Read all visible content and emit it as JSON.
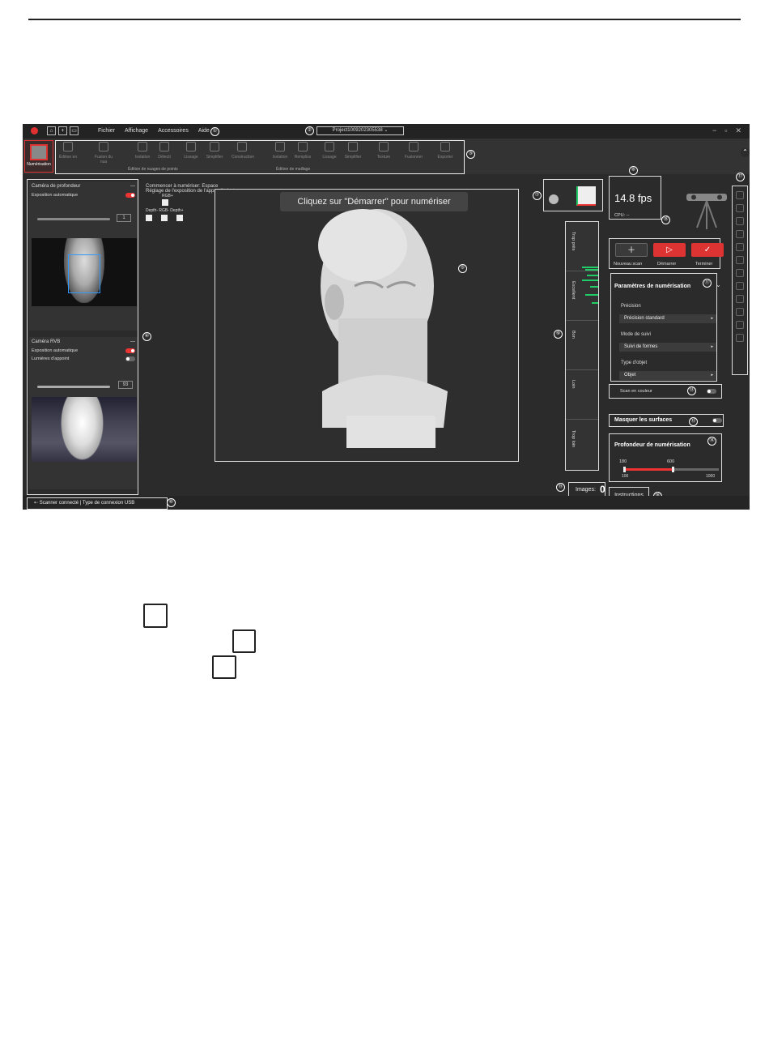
{
  "app": {
    "menu": [
      "Fichier",
      "Affichage",
      "Accessoires",
      "Aide"
    ],
    "project": "Project1009202305538 ⌄",
    "window_controls": [
      "−",
      "▫",
      "✕"
    ],
    "annotations": {
      "a1": "①",
      "a2": "②",
      "a3": "③",
      "a4": "④",
      "a5": "⑤",
      "a6": "⑥",
      "a7": "⑦",
      "a8": "⑧",
      "a9": "⑨",
      "a10": "⑩",
      "a11": "⑪",
      "a12": "⑫",
      "a13": "⑬",
      "a14": "⑭",
      "a15": "⑮",
      "a16": "⑯",
      "a17": "⑰",
      "a18": "⑱"
    },
    "toolbar": {
      "scan_label": "Numérisation",
      "tools": [
        "Édition en",
        "Fusion du nua",
        "Isolation",
        "Détecti",
        "Lissage",
        "Simplifier",
        "Construction",
        "Isolation",
        "Rempliss",
        "Lissage",
        "Simplifier",
        "Texture",
        "Fusionner",
        "Exporter"
      ],
      "group1": "Édition de nuages de points",
      "group2": "Édition de maillage"
    },
    "depth_camera": {
      "title": "Caméra de profondeur",
      "auto_exposure": "Exposition automatique",
      "value": "1"
    },
    "rgb_camera": {
      "title": "Caméra RVB",
      "auto_exposure": "Exposition automatique",
      "fill_light": "Lumières d'appoint",
      "value": "93"
    },
    "start": {
      "line1": "Commencer à numériser: Espace",
      "line2": "Réglage de l'exposition de l'appareil photo:",
      "rgb_plus": "RGB+",
      "labels": "Depth-  RGB-  Depth+"
    },
    "viewport_message": "Cliquez sur \"Démarrer\" pour numériser",
    "quality_levels": [
      "Trop près",
      "Excellent",
      "Bon",
      "Loin",
      "Trop loin"
    ],
    "images_label": "Images:",
    "images_count": "0",
    "fps": "14.8 fps",
    "cpu": "CPU: --",
    "buttons": {
      "new_scan": "Nouveau scan",
      "start": "Démarrer",
      "finish": "Terminer"
    },
    "params": {
      "title": "Paramètres de numérisation",
      "precision_label": "Précision",
      "precision_value": "Précision standard",
      "tracking_label": "Mode de suivi",
      "tracking_value": "Suivi de formes",
      "object_label": "Type d'objet",
      "object_value": "Objet"
    },
    "color_scan": "Scan en couleur",
    "hide_surfaces": "Masquer les surfaces",
    "depth": {
      "title": "Profondeur de numérisation",
      "min_sel": "180",
      "max_sel": "600",
      "min": "100",
      "max": "1000"
    },
    "instructions": "Instructions",
    "status": "Scanner connecté | Type de connexion USB"
  }
}
